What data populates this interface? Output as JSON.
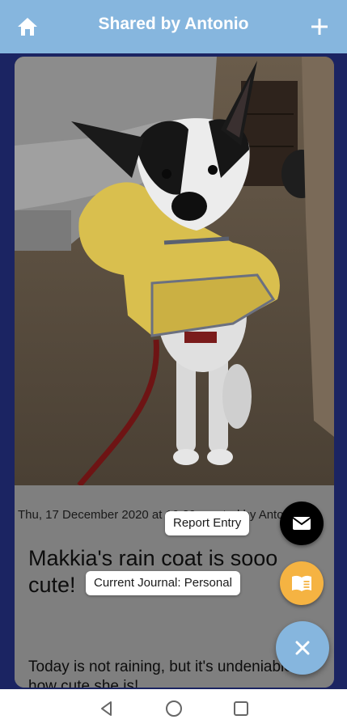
{
  "header": {
    "title": "Shared by Antonio",
    "left_icon": "home-icon",
    "right_icon": "plus-icon",
    "color": "#86b6de"
  },
  "entry": {
    "meta": "Thu, 17 December 2020 at 10:29 created by Antonio",
    "title": "Makkia's rain coat is sooo cute!",
    "text": "Today is not raining, but it's undeniable how cute she is!"
  },
  "fab_menu": {
    "report": {
      "label": "Report Entry",
      "icon": "mail-icon",
      "color": "#000000"
    },
    "journal": {
      "label": "Current Journal: Personal",
      "icon": "book-icon",
      "color": "#f5b342"
    },
    "close": {
      "icon": "close-icon",
      "color": "#86b6de"
    }
  },
  "system_nav": {
    "back": "back-icon",
    "home": "home-circle-icon",
    "recents": "recents-icon"
  }
}
